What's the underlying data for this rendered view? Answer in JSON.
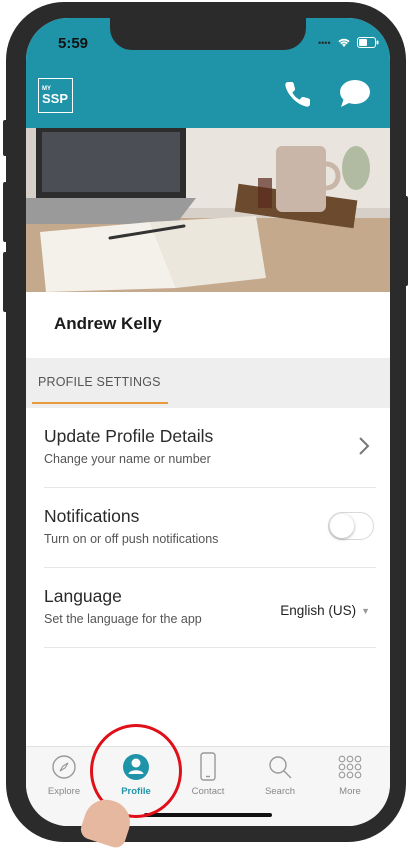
{
  "status": {
    "time": "5:59"
  },
  "header": {
    "logo_small": "MY",
    "logo_big": "SSP",
    "phone_icon": "phone-icon",
    "chat_icon": "chat-bubble-icon",
    "bg_color": "#1f94a8"
  },
  "profile": {
    "name": "Andrew Kelly"
  },
  "section": {
    "label": "PROFILE SETTINGS",
    "accent": "#e89a3c"
  },
  "settings": {
    "update": {
      "title": "Update Profile Details",
      "subtitle": "Change your name or number"
    },
    "notifications": {
      "title": "Notifications",
      "subtitle": "Turn on or off push notifications",
      "enabled": false
    },
    "language": {
      "title": "Language",
      "subtitle": "Set the language for the app",
      "value": "English (US)"
    }
  },
  "tabs": [
    {
      "label": "Explore",
      "icon": "compass-icon",
      "active": false
    },
    {
      "label": "Profile",
      "icon": "person-icon",
      "active": true
    },
    {
      "label": "Contact",
      "icon": "mobile-phone-icon",
      "active": false
    },
    {
      "label": "Search",
      "icon": "search-icon",
      "active": false
    },
    {
      "label": "More",
      "icon": "grid-dots-icon",
      "active": false
    }
  ]
}
